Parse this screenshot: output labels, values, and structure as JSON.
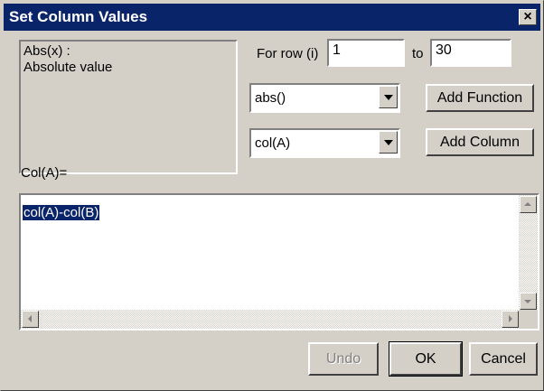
{
  "dialog": {
    "title": "Set Column Values",
    "close_label": "×"
  },
  "description": {
    "function_sig": "Abs(x) :",
    "function_desc": "Absolute value"
  },
  "row_range": {
    "for_row_label": "For row (i)",
    "from_value": "1",
    "to_label": "to",
    "to_value": "30"
  },
  "function_combo": {
    "selected": "abs()"
  },
  "column_combo": {
    "selected": "col(A)"
  },
  "buttons": {
    "add_function": "Add Function",
    "add_column": "Add Column",
    "undo": "Undo",
    "ok": "OK",
    "cancel": "Cancel"
  },
  "formula": {
    "target_label": "Col(A)=",
    "expression": "col(A)-col(B)"
  }
}
